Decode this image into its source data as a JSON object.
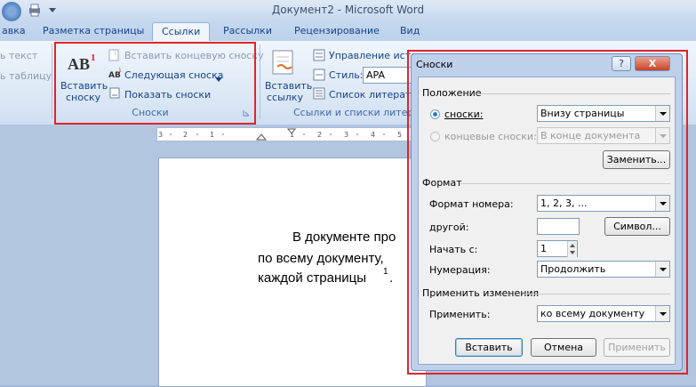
{
  "window": {
    "title": "Документ2 - Microsoft Word"
  },
  "tabs": [
    "авка",
    "Разметка страницы",
    "Ссылки",
    "Рассылки",
    "Рецензирование",
    "Вид"
  ],
  "ribbon": {
    "left_items": [
      "ь текст",
      "ь таблицу"
    ],
    "footnotes_group": {
      "insert_footnote": [
        "Вставить",
        "сноску"
      ],
      "insert_endnote": "Вставить концевую сноску",
      "next_footnote": "Следующая сноска",
      "show_notes": "Показать сноски",
      "label": "Сноски"
    },
    "citations_group": {
      "insert_citation": [
        "Вставить",
        "ссылку"
      ],
      "manage_sources": "Управление исто",
      "style_label": "Стиль:",
      "style_value": "APA",
      "bibliography": "Список литерат",
      "label": "Ссылки и списки литерат"
    }
  },
  "document": {
    "lines": [
      "В документе про",
      "по всему документу,",
      "каждой страницы"
    ],
    "footnote_mark": "1",
    "line_end_period": "."
  },
  "dialog": {
    "title": "Сноски",
    "help_btn": "?",
    "close_btn": "X",
    "position": {
      "section": "Положение",
      "footnotes_label": "сноски:",
      "footnotes_value": "Внизу страницы",
      "endnotes_label": "концевые сноски:",
      "endnotes_value": "В конце документа",
      "replace_btn": "Заменить..."
    },
    "format": {
      "section": "Формат",
      "number_format_label": "Формат номера:",
      "number_format_value": "1, 2, 3, ...",
      "custom_label": "другой:",
      "custom_value": "",
      "symbol_btn": "Символ...",
      "start_label": "Начать с:",
      "start_value": "1",
      "numbering_label": "Нумерация:",
      "numbering_value": "Продолжить"
    },
    "apply": {
      "section": "Применить изменения",
      "apply_label": "Применить:",
      "apply_value": "ко всему документу"
    },
    "buttons": {
      "insert": "Вставить",
      "cancel": "Отмена",
      "apply": "Применить"
    }
  },
  "colors": {
    "highlight": "#e0242b",
    "ribbon_text": "#15428b"
  }
}
